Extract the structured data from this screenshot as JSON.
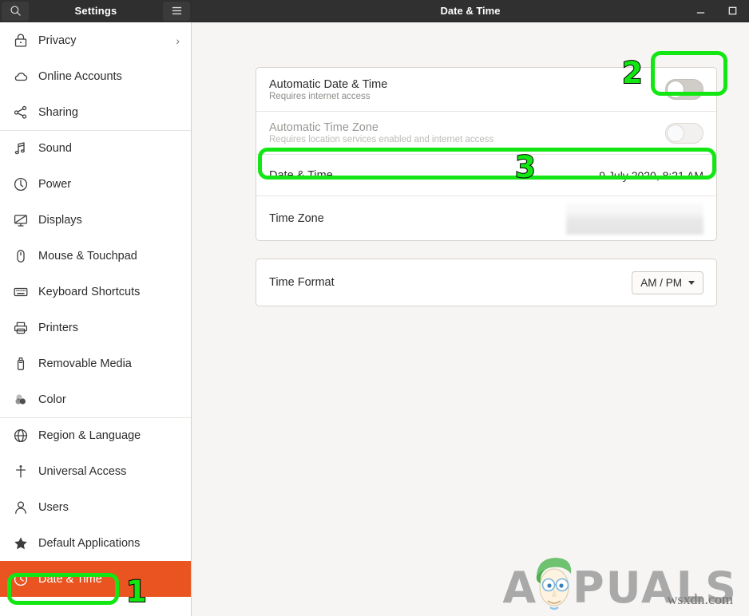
{
  "window": {
    "left_title": "Settings",
    "main_title": "Date & Time",
    "search_icon": "search-icon",
    "menu_icon": "hamburger-menu-icon",
    "minimize_label": "–",
    "maximize_label": "□"
  },
  "sidebar": {
    "items": [
      {
        "label": "Privacy",
        "icon": "lock-icon",
        "chevron": "›",
        "separator_above": false,
        "selected": false
      },
      {
        "label": "Online Accounts",
        "icon": "cloud-icon",
        "chevron": "",
        "separator_above": false,
        "selected": false
      },
      {
        "label": "Sharing",
        "icon": "share-nodes-icon",
        "chevron": "",
        "separator_above": false,
        "selected": false
      },
      {
        "label": "Sound",
        "icon": "music-note-icon",
        "chevron": "",
        "separator_above": true,
        "selected": false
      },
      {
        "label": "Power",
        "icon": "power-icon",
        "chevron": "",
        "separator_above": false,
        "selected": false
      },
      {
        "label": "Displays",
        "icon": "monitor-icon",
        "chevron": "",
        "separator_above": false,
        "selected": false
      },
      {
        "label": "Mouse & Touchpad",
        "icon": "mouse-icon",
        "chevron": "",
        "separator_above": false,
        "selected": false
      },
      {
        "label": "Keyboard Shortcuts",
        "icon": "keyboard-icon",
        "chevron": "",
        "separator_above": false,
        "selected": false
      },
      {
        "label": "Printers",
        "icon": "printer-icon",
        "chevron": "",
        "separator_above": false,
        "selected": false
      },
      {
        "label": "Removable Media",
        "icon": "usb-drive-icon",
        "chevron": "",
        "separator_above": false,
        "selected": false
      },
      {
        "label": "Color",
        "icon": "color-circles-icon",
        "chevron": "",
        "separator_above": false,
        "selected": false
      },
      {
        "label": "Region & Language",
        "icon": "globe-icon",
        "chevron": "",
        "separator_above": true,
        "selected": false
      },
      {
        "label": "Universal Access",
        "icon": "accessibility-icon",
        "chevron": "",
        "separator_above": false,
        "selected": false
      },
      {
        "label": "Users",
        "icon": "user-icon",
        "chevron": "",
        "separator_above": false,
        "selected": false
      },
      {
        "label": "Default Applications",
        "icon": "star-icon",
        "chevron": "",
        "separator_above": false,
        "selected": false
      },
      {
        "label": "Date & Time",
        "icon": "clock-icon",
        "chevron": "",
        "separator_above": false,
        "selected": true
      }
    ],
    "selected_color": "#e95420"
  },
  "main": {
    "rows": [
      {
        "title": "Automatic Date & Time",
        "subtitle": "Requires internet access",
        "control": "toggle",
        "toggle_state": "off",
        "enabled": true
      },
      {
        "title": "Automatic Time Zone",
        "subtitle": "Requires location services enabled and internet access",
        "control": "toggle",
        "toggle_state": "off",
        "enabled": false
      },
      {
        "title": "Date & Time",
        "subtitle": "",
        "control": "value",
        "value": "9 July 2020,  8:21 AM",
        "enabled": true
      },
      {
        "title": "Time Zone",
        "subtitle": "",
        "control": "blurred",
        "value": "",
        "enabled": true
      }
    ],
    "time_format": {
      "label": "Time Format",
      "value": "AM / PM",
      "caret": "chevron-down-icon"
    }
  },
  "annotations": {
    "color": "#13e713",
    "markers": [
      {
        "number": "1",
        "target": "sidebar-item-date-and-time"
      },
      {
        "number": "2",
        "target": "automatic-date-time-toggle"
      },
      {
        "number": "3",
        "target": "date-and-time-row"
      }
    ]
  },
  "watermark": {
    "brand": "APPUALS",
    "brand_a": "A",
    "brand_rest": "PUALS",
    "domain": "wsxdn.com"
  }
}
